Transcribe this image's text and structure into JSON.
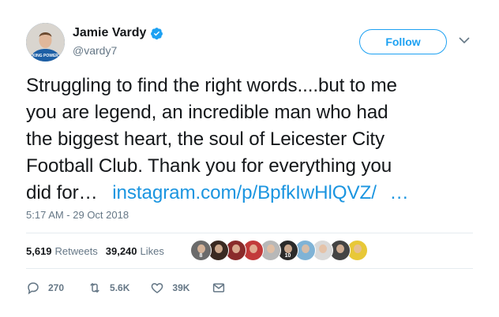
{
  "author": {
    "name": "Jamie Vardy",
    "handle": "@vardy7",
    "avatar_caption": "KING POWER"
  },
  "follow_label": "Follow",
  "tweet": {
    "lines": [
      "Struggling to find the right words....but to me",
      "you are legend, an incredible man who had",
      "the biggest heart, the soul of Leicester City",
      "Football Club. Thank you for everything you"
    ],
    "last_line_text": "did for…",
    "link_text": "instagram.com/p/BpfkIwHlQVZ/",
    "ellipsis": "…",
    "timestamp": "5:17 AM - 29 Oct 2018"
  },
  "stats": {
    "retweets_count": "5,619",
    "retweets_label": "Retweets",
    "likes_count": "39,240",
    "likes_label": "Likes"
  },
  "likers": [
    {
      "color": "#6b6b6b",
      "label": "8"
    },
    {
      "color": "#3a2a22",
      "label": ""
    },
    {
      "color": "#8a2b2b",
      "label": ""
    },
    {
      "color": "#c23a3a",
      "label": ""
    },
    {
      "color": "#b8b8b8",
      "label": ""
    },
    {
      "color": "#2b2b2b",
      "label": "10"
    },
    {
      "color": "#7fb3d6",
      "label": ""
    },
    {
      "color": "#d9d9d9",
      "label": ""
    },
    {
      "color": "#444444",
      "label": ""
    },
    {
      "color": "#e8c838",
      "label": ""
    }
  ],
  "actions": {
    "replies": "270",
    "retweets": "5.6K",
    "likes": "39K"
  },
  "colors": {
    "accent": "#1da1f2",
    "link": "#1b95e0",
    "muted": "#657786"
  }
}
